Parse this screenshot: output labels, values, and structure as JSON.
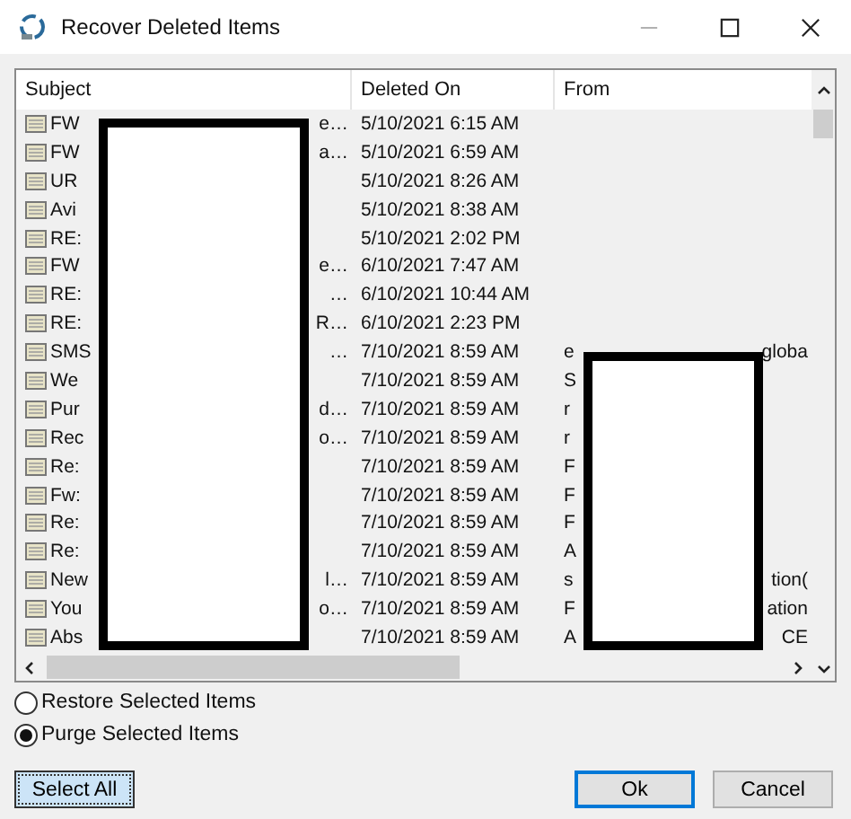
{
  "window": {
    "title": "Recover Deleted Items"
  },
  "table": {
    "columns": [
      "Subject",
      "Deleted On",
      "From"
    ],
    "rows": [
      {
        "subject": "FW",
        "subject_tail": "e…",
        "deleted_on": "5/10/2021 6:15 AM"
      },
      {
        "subject": "FW",
        "subject_tail": "a…",
        "deleted_on": "5/10/2021 6:59 AM"
      },
      {
        "subject": "UR",
        "deleted_on": "5/10/2021 8:26 AM"
      },
      {
        "subject": "Avi",
        "deleted_on": "5/10/2021 8:38 AM"
      },
      {
        "subject": "RE:",
        "deleted_on": "5/10/2021 2:02 PM"
      },
      {
        "subject": "FW",
        "subject_tail": "e…",
        "deleted_on": "6/10/2021 7:47 AM"
      },
      {
        "subject": "RE:",
        "subject_tail": "…",
        "deleted_on": "6/10/2021 10:44 AM"
      },
      {
        "subject": "RE:",
        "subject_tail": "R…",
        "deleted_on": "6/10/2021 2:23 PM"
      },
      {
        "subject": "SMS",
        "subject_tail": "…",
        "deleted_on": "7/10/2021 8:59 AM",
        "from": "e",
        "from_tail": "globa"
      },
      {
        "subject": "We",
        "deleted_on": "7/10/2021 8:59 AM",
        "from": "S"
      },
      {
        "subject": "Pur",
        "subject_tail": "d…",
        "deleted_on": "7/10/2021 8:59 AM",
        "from": "r"
      },
      {
        "subject": "Rec",
        "subject_tail": "o…",
        "deleted_on": "7/10/2021 8:59 AM",
        "from": "r"
      },
      {
        "subject": "Re:",
        "deleted_on": "7/10/2021 8:59 AM",
        "from": "F"
      },
      {
        "subject": "Fw:",
        "deleted_on": "7/10/2021 8:59 AM",
        "from": "F"
      },
      {
        "subject": "Re:",
        "deleted_on": "7/10/2021 8:59 AM",
        "from": "F"
      },
      {
        "subject": "Re:",
        "deleted_on": "7/10/2021 8:59 AM",
        "from": "A"
      },
      {
        "subject": "New",
        "subject_tail": "l…",
        "deleted_on": "7/10/2021 8:59 AM",
        "from": "s",
        "from_tail": "tion("
      },
      {
        "subject": "You",
        "subject_tail": "o…",
        "deleted_on": "7/10/2021 8:59 AM",
        "from": "F",
        "from_tail": "ation"
      },
      {
        "subject": "Abs",
        "deleted_on": "7/10/2021 8:59 AM",
        "from": "A",
        "from_tail": "CE"
      }
    ]
  },
  "options": [
    {
      "label": "Restore Selected Items",
      "selected": false
    },
    {
      "label": "Purge Selected Items",
      "selected": true
    }
  ],
  "buttons": [
    {
      "label": "Select All",
      "kind": "focused"
    },
    {
      "label": "Ok",
      "kind": "default"
    },
    {
      "label": "Cancel",
      "kind": "normal"
    }
  ]
}
